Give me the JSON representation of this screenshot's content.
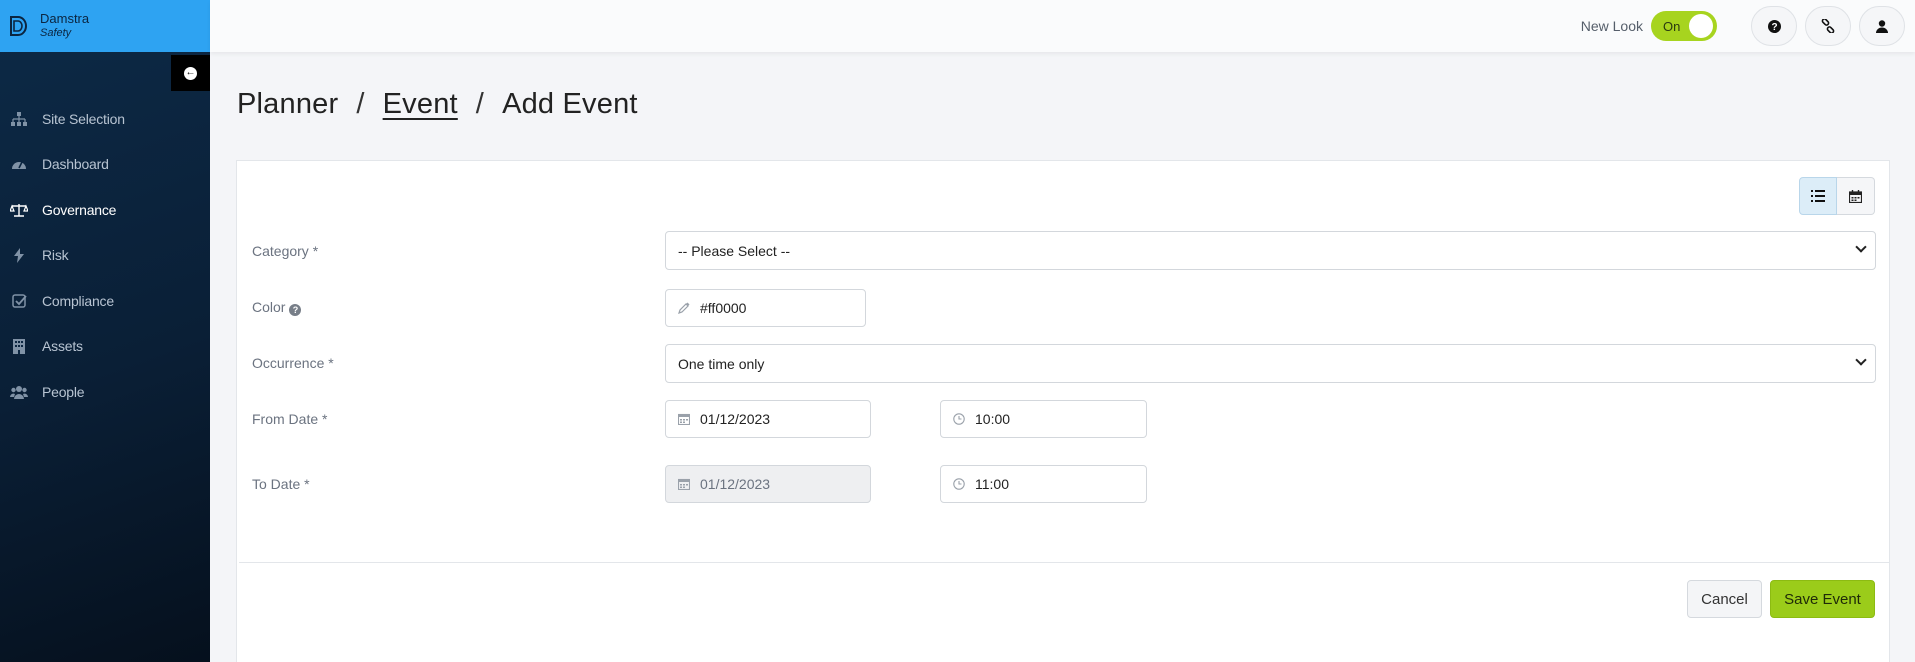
{
  "brand": {
    "name": "Damstra",
    "subtitle": "Safety"
  },
  "sidebar": {
    "items": [
      {
        "label": "Site Selection",
        "icon": "sitemap-icon"
      },
      {
        "label": "Dashboard",
        "icon": "dashboard-icon"
      },
      {
        "label": "Governance",
        "icon": "balance-scale-icon",
        "active": true
      },
      {
        "label": "Risk",
        "icon": "bolt-icon"
      },
      {
        "label": "Compliance",
        "icon": "check-square-icon"
      },
      {
        "label": "Assets",
        "icon": "building-icon"
      },
      {
        "label": "People",
        "icon": "users-icon"
      }
    ]
  },
  "topbar": {
    "new_look_label": "New Look",
    "toggle_text": "On",
    "toggle_on": true,
    "icons": [
      "help-icon",
      "link-icon",
      "user-icon"
    ]
  },
  "breadcrumb": {
    "planner": "Planner",
    "event": "Event",
    "current": "Add Event",
    "separator": "/"
  },
  "form": {
    "category": {
      "label": "Category *",
      "value": "-- Please Select --"
    },
    "color": {
      "label": "Color",
      "value": "#ff0000"
    },
    "occurrence": {
      "label": "Occurrence *",
      "value": "One time only"
    },
    "from_date": {
      "label": "From Date *",
      "date": "01/12/2023",
      "time": "10:00"
    },
    "to_date": {
      "label": "To Date *",
      "date": "01/12/2023",
      "time": "11:00"
    }
  },
  "buttons": {
    "cancel": "Cancel",
    "save": "Save Event"
  },
  "colors": {
    "brand": "#2ea3f2",
    "accent": "#9bcc1a",
    "sidebar": "#0d2a47"
  }
}
